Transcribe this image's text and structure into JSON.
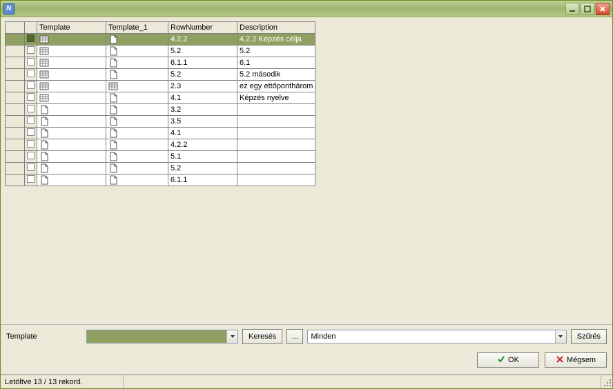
{
  "window": {
    "title": ""
  },
  "grid": {
    "columns": [
      "",
      "",
      "Template",
      "Template_1",
      "RowNumber",
      "Description"
    ],
    "rows": [
      {
        "selected": true,
        "icon1": "grid",
        "icon2": "page",
        "rownum": "4.2.2",
        "desc": "4.2.2 Képzés célja"
      },
      {
        "selected": false,
        "icon1": "grid",
        "icon2": "page",
        "rownum": "5.2",
        "desc": "5.2"
      },
      {
        "selected": false,
        "icon1": "grid",
        "icon2": "page",
        "rownum": "6.1.1",
        "desc": "6.1"
      },
      {
        "selected": false,
        "icon1": "grid",
        "icon2": "page",
        "rownum": "5.2",
        "desc": "5.2 második"
      },
      {
        "selected": false,
        "icon1": "grid",
        "icon2": "grid",
        "rownum": "2.3",
        "desc": "ez egy ettőponthárom"
      },
      {
        "selected": false,
        "icon1": "grid",
        "icon2": "page",
        "rownum": "4.1",
        "desc": "Képzés nyelve"
      },
      {
        "selected": false,
        "icon1": "page",
        "icon2": "page",
        "rownum": "3.2",
        "desc": ""
      },
      {
        "selected": false,
        "icon1": "page",
        "icon2": "page",
        "rownum": "3.5",
        "desc": ""
      },
      {
        "selected": false,
        "icon1": "page",
        "icon2": "page",
        "rownum": "4.1",
        "desc": ""
      },
      {
        "selected": false,
        "icon1": "page",
        "icon2": "page",
        "rownum": "4.2.2",
        "desc": ""
      },
      {
        "selected": false,
        "icon1": "page",
        "icon2": "page",
        "rownum": "5.1",
        "desc": ""
      },
      {
        "selected": false,
        "icon1": "page",
        "icon2": "page",
        "rownum": "5.2",
        "desc": ""
      },
      {
        "selected": false,
        "icon1": "page",
        "icon2": "page",
        "rownum": "6.1.1",
        "desc": ""
      }
    ]
  },
  "filter": {
    "label": "Template",
    "search_label": "Keresés",
    "more_label": "...",
    "scope_value": "Minden",
    "filter_label": "Szűrés"
  },
  "buttons": {
    "ok": "OK",
    "cancel": "Mégsem"
  },
  "status": {
    "text": "Letöltve 13 / 13 rekord."
  }
}
